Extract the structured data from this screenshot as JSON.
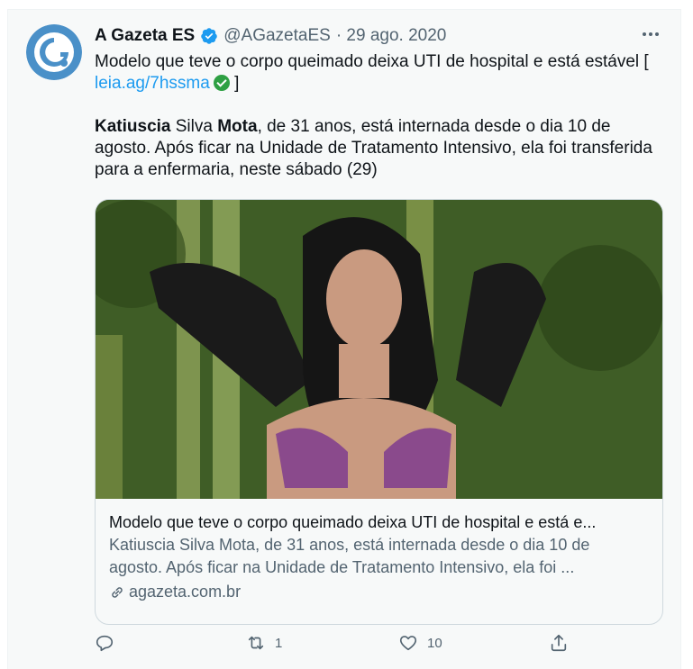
{
  "account": {
    "name": "A Gazeta ES",
    "handle": "@AGazetaES",
    "date": "· 29 ago. 2020",
    "avatar_letter": "G"
  },
  "tweet": {
    "line1_text": "Modelo que teve o corpo queimado deixa UTI de hospital e está estável [ ",
    "link_text": "leia.ag/7hssma",
    "line1_close": " ]",
    "para2_name1": "Katiuscia",
    "para2_name_mid": " Silva ",
    "para2_name2": "Mota",
    "para2_rest": ", de 31 anos,  está internada desde o dia 10 de agosto. Após ficar na Unidade de Tratamento Intensivo, ela foi transferida para a enfermaria, neste sábado (29)"
  },
  "card": {
    "title": "Modelo que teve o corpo queimado deixa UTI de hospital e está e...",
    "description_line1": "Katiuscia Silva Mota, de 31 anos,  está internada desde o dia 10 de",
    "description_line2": "agosto. Após ficar na Unidade de Tratamento Intensivo, ela foi ...",
    "domain": "agazeta.com.br"
  },
  "actions": {
    "reply_count": "",
    "retweet_count": "1",
    "like_count": "10"
  },
  "colors": {
    "link": "#1d9bf0",
    "verified": "#1d9bf0",
    "secondary_text": "#536471",
    "avatar_bg": "#3a8fd6"
  },
  "icons": [
    "verified-badge-icon",
    "more-options-icon",
    "check-circle-icon",
    "link-icon",
    "reply-icon",
    "retweet-icon",
    "like-icon",
    "share-icon"
  ]
}
